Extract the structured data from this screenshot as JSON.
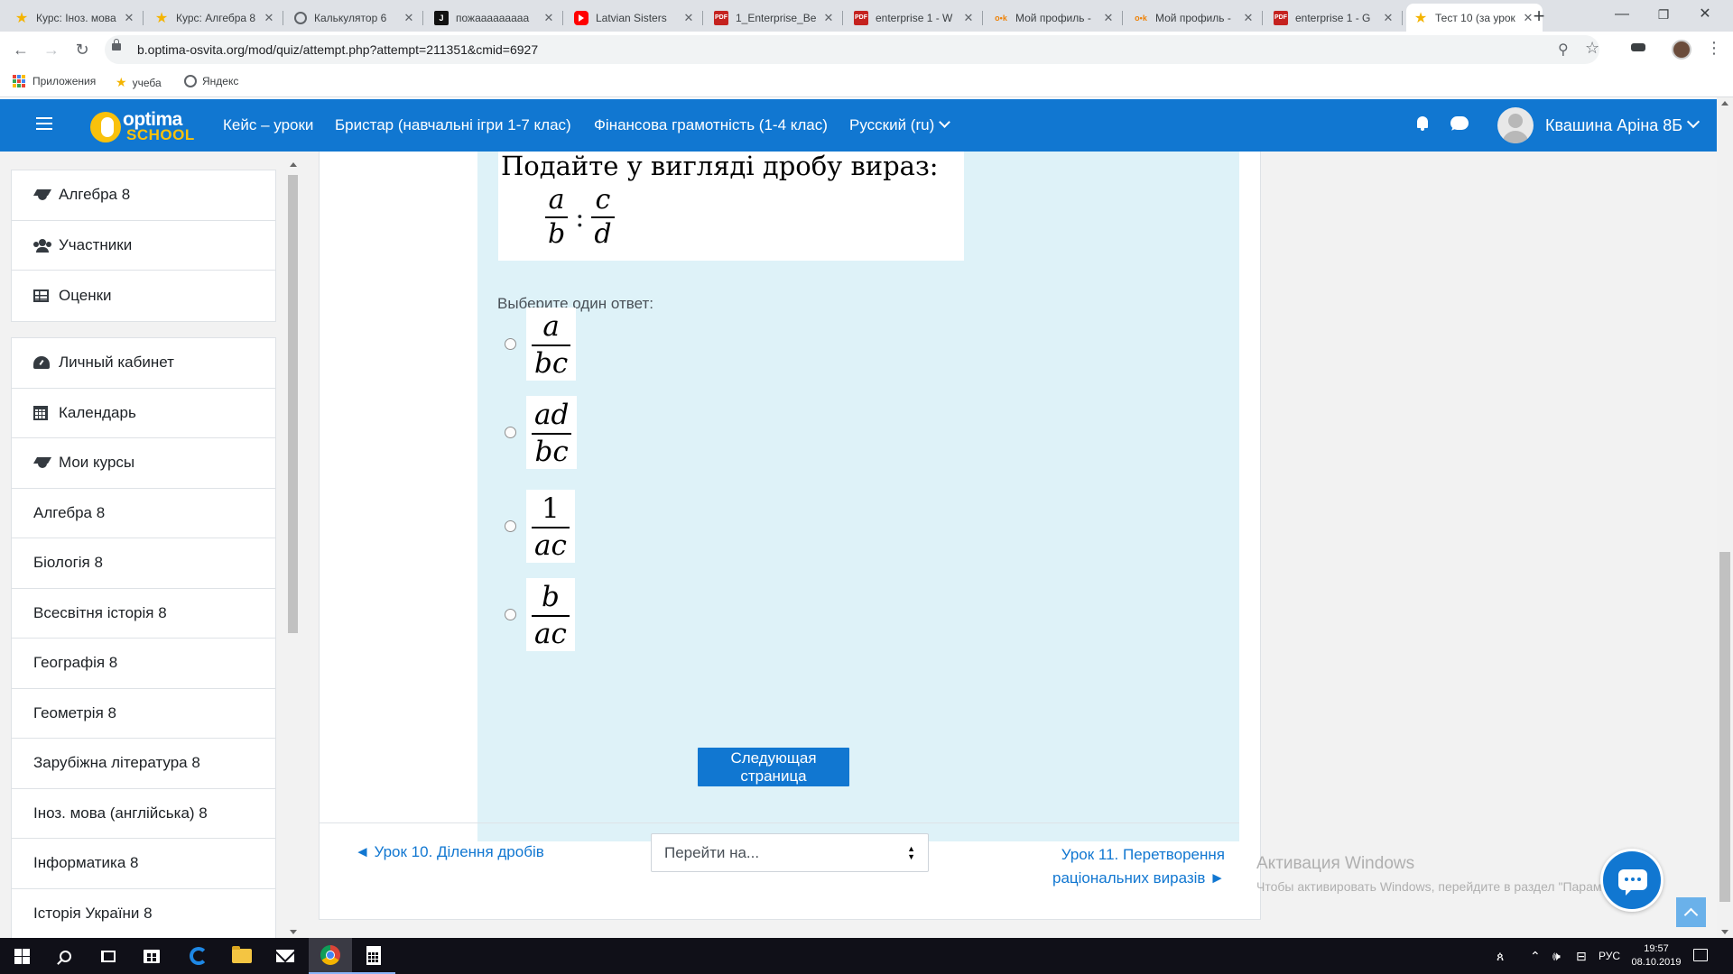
{
  "browser": {
    "tabs": [
      {
        "title": "Курс: Іноз. мова",
        "favicon": "star-icon"
      },
      {
        "title": "Курс: Алгебра 8",
        "favicon": "star-icon"
      },
      {
        "title": "Калькулятор 6",
        "favicon": "globe-icon"
      },
      {
        "title": "пожааааааааа",
        "favicon": "j-icon"
      },
      {
        "title": "Latvian Sisters",
        "favicon": "youtube-icon"
      },
      {
        "title": "1_Enterprise_Be",
        "favicon": "pdf-icon"
      },
      {
        "title": "enterprise 1 - W",
        "favicon": "pdf-icon"
      },
      {
        "title": "Мой профиль -",
        "favicon": "ok-icon"
      },
      {
        "title": "Мой профиль -",
        "favicon": "ok-icon"
      },
      {
        "title": "enterprise 1 - G",
        "favicon": "pdf-icon"
      },
      {
        "title": "Тест 10 (за урок",
        "favicon": "star-icon",
        "active": true
      }
    ],
    "favicon_texts": {
      "pdf": "PDF",
      "ok": "o•k",
      "j": "J"
    },
    "url": "b.optima-osvita.org/mod/quiz/attempt.php?attempt=211351&cmid=6927",
    "bookmarks": [
      {
        "label": "Приложения",
        "icon": "apps-grid-icon"
      },
      {
        "label": "учеба",
        "icon": "star-icon"
      },
      {
        "label": "Яндекс",
        "icon": "globe-icon"
      }
    ],
    "glyphs": {
      "back": "←",
      "forward": "→",
      "reload": "↻",
      "zoom": "⚲",
      "star": "☆",
      "new_tab": "+",
      "minimize": "—",
      "restore": "❐",
      "close": "✕",
      "tab_close": "✕",
      "star_filled": "★",
      "menu": "⋮"
    }
  },
  "moodle": {
    "logo": {
      "word1": "optima",
      "word2": "SCHOOL"
    },
    "nav_links": [
      "Кейс – уроки",
      "Бристар (навчальні ігри 1-7 клас)",
      "Фінансова грамотність (1-4 клас)",
      "Русский ‎(ru)‎"
    ],
    "user_name": "Квашина Аріна 8Б",
    "brand_color": "#1177d1"
  },
  "drawer": {
    "block1": [
      {
        "label": "Алгебра 8",
        "icon": "graduation-cap-icon"
      },
      {
        "label": "Участники",
        "icon": "users-icon"
      },
      {
        "label": "Оценки",
        "icon": "table-icon"
      }
    ],
    "block2": [
      {
        "label": "Личный кабинет",
        "icon": "dashboard-icon"
      },
      {
        "label": "Календарь",
        "icon": "calendar-icon"
      },
      {
        "label": "Мои курсы",
        "icon": "graduation-cap-icon"
      },
      {
        "label": "Алгебра 8"
      },
      {
        "label": "Біологія 8"
      },
      {
        "label": "Всесвітня історія 8"
      },
      {
        "label": "Географія 8"
      },
      {
        "label": "Геометрія 8"
      },
      {
        "label": "Зарубіжна література 8"
      },
      {
        "label": "Іноз. мова (англійська) 8"
      },
      {
        "label": "Інформатика 8"
      },
      {
        "label": "Історія України 8"
      }
    ]
  },
  "question": {
    "text": "Подайте у вигляді дробу вираз:",
    "expression": {
      "left": {
        "num": "a",
        "den": "b"
      },
      "op": ":",
      "right": {
        "num": "c",
        "den": "d"
      }
    },
    "prompt": "Выберите один ответ:",
    "options": [
      {
        "num": "a",
        "den": "bc"
      },
      {
        "num": "ad",
        "den": "bc"
      },
      {
        "num": "1",
        "den": "ac"
      },
      {
        "num": "b",
        "den": "ac"
      }
    ],
    "background": "#def2f8"
  },
  "actions": {
    "next_page": "Следующая страница",
    "prev_link": "◄ Урок 10. Ділення дробів",
    "jump_select": "Перейти на...",
    "next_link_line1": "Урок 11. Перетворення",
    "next_link_line2": "раціональних виразів ►"
  },
  "watermark": {
    "title": "Активация Windows",
    "subtitle": "Чтобы активировать Windows, перейдите в раздел \"Параметры\"."
  },
  "taskbar": {
    "apps": [
      "windows-start-icon",
      "search-icon",
      "task-view-icon",
      "store-icon",
      "edge-icon",
      "file-explorer-icon",
      "mail-icon",
      "chrome-icon",
      "calculator-icon"
    ],
    "tray": {
      "person": "ጰ",
      "up_chevron": "⌃",
      "volume": "🕪",
      "network": "⊟",
      "lang": "РУС"
    },
    "time": "19:57",
    "date": "08.10.2019"
  }
}
